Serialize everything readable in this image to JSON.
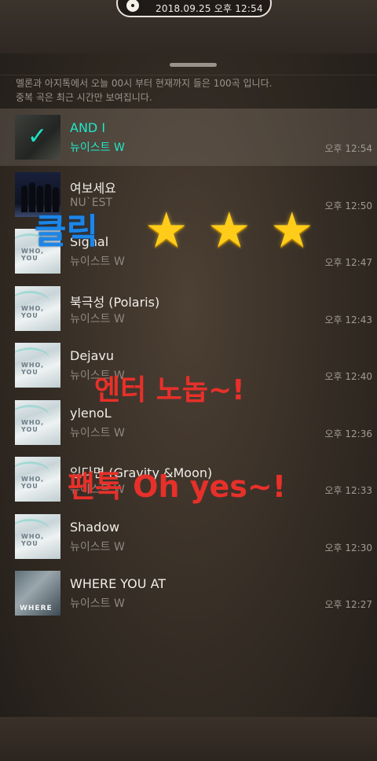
{
  "status": {
    "datetime": "2018.09.25 오후 12:54"
  },
  "notice": {
    "line1": "멜론과 아지톡에서 오늘 00시 부터 현재까지 들은 100곡 입니다.",
    "line2": "중복 곡은 최근 시간만 보여집니다."
  },
  "songs": [
    {
      "title": "AND I",
      "artist": "뉴이스트 W",
      "time": "오후 12:54",
      "selected": true
    },
    {
      "title": "여보세요",
      "artist": "NU`EST",
      "time": "오후 12:50"
    },
    {
      "title": "Signal",
      "artist": "뉴이스트 W",
      "time": "오후 12:47"
    },
    {
      "title": "북극성 (Polaris)",
      "artist": "뉴이스트 W",
      "time": "오후 12:43"
    },
    {
      "title": "Dejavu",
      "artist": "뉴이스트 W",
      "time": "오후 12:40"
    },
    {
      "title": "ylenoL",
      "artist": "뉴이스트 W",
      "time": "오후 12:36"
    },
    {
      "title": "있다면 (Gravity &Moon)",
      "artist": "뉴이스트 W",
      "time": "오후 12:33"
    },
    {
      "title": "Shadow",
      "artist": "뉴이스트 W",
      "time": "오후 12:30"
    },
    {
      "title": "WHERE YOU AT",
      "artist": "뉴이스트 W",
      "time": "오후 12:27"
    }
  ],
  "album_art": {
    "wm_text": "WHO, YOU",
    "where_text": "WHERE"
  },
  "overlays": {
    "click": "클릭",
    "enter": "엔터 노놉~!",
    "fan": "팬톡 Oh yes~!",
    "stars": [
      "★",
      "★",
      "★"
    ]
  },
  "colors": {
    "selected_text": "#1fe9c8",
    "overlay_blue": "#1c86e8",
    "overlay_red": "#e7302a",
    "star_gold": "#ffcc1a"
  }
}
